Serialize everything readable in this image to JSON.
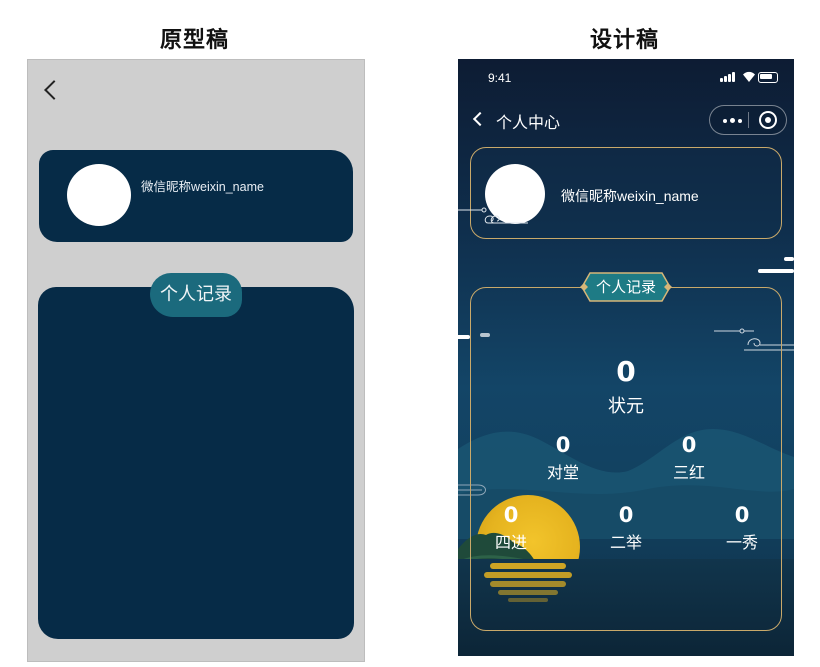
{
  "headings": {
    "prototype": "原型稿",
    "design": "设计稿"
  },
  "prototype": {
    "nickname": "微信昵称weixin_name",
    "tag_label": "个人记录"
  },
  "design": {
    "status_time": "9:41",
    "nav_title": "个人中心",
    "nickname": "微信昵称weixin_name",
    "tag_label": "个人记录",
    "stats": {
      "zhuangyuan": {
        "value": "0",
        "label": "状元"
      },
      "duitang": {
        "value": "0",
        "label": "对堂"
      },
      "sanhong": {
        "value": "0",
        "label": "三红"
      },
      "sijin": {
        "value": "0",
        "label": "四进"
      },
      "erju": {
        "value": "0",
        "label": "二举"
      },
      "yixiu": {
        "value": "0",
        "label": "一秀"
      }
    },
    "colors": {
      "gold_border": "#c9a96a",
      "teal_tag": "#1e7b85",
      "moon": "#e5b31f",
      "navy": "#062b47"
    }
  }
}
